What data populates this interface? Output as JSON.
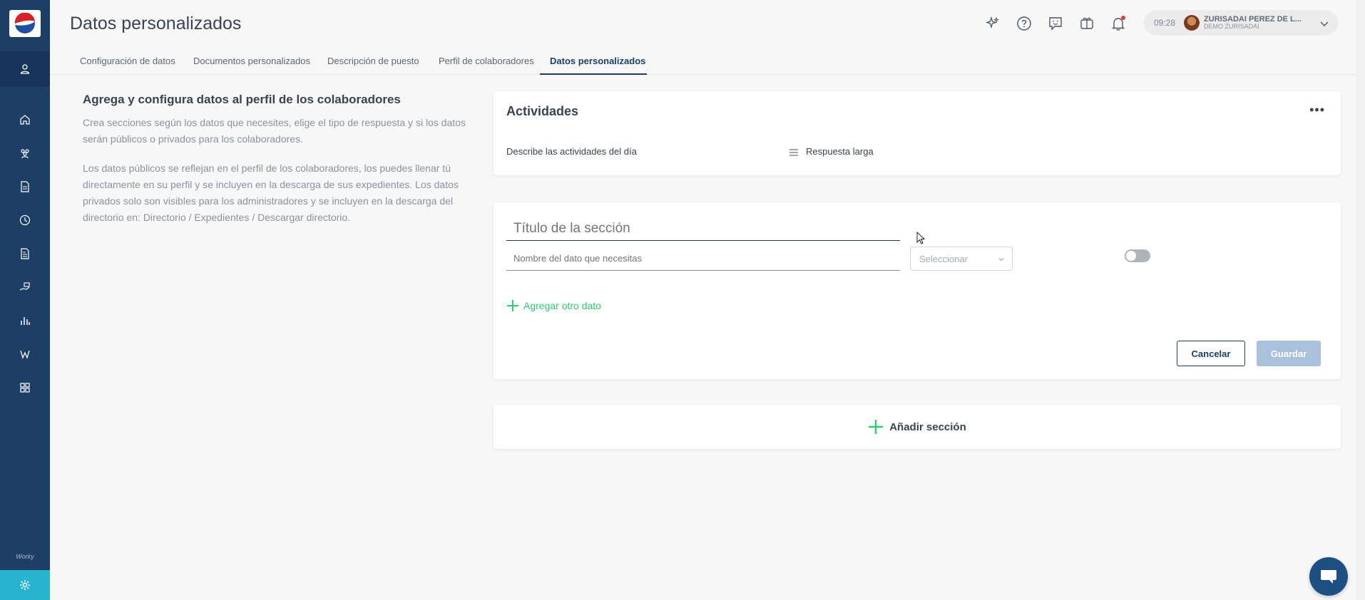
{
  "app": {
    "title": "Datos personalizados",
    "brand_color": "#1d3f66",
    "accent_color": "#2ecc71",
    "settings_color": "#28b4cf"
  },
  "sidebar": {
    "items": [
      {
        "icon": "user-icon"
      },
      {
        "icon": "home-icon"
      },
      {
        "icon": "users-icon"
      },
      {
        "icon": "document-icon"
      },
      {
        "icon": "clock-icon"
      },
      {
        "icon": "file-text-icon"
      },
      {
        "icon": "hand-money-icon"
      },
      {
        "icon": "bar-chart-icon"
      },
      {
        "icon": "network-icon"
      },
      {
        "icon": "grid-icon"
      }
    ],
    "footer_label": "Worky",
    "settings_icon": "gear-icon"
  },
  "header": {
    "icons": [
      "sparkles-icon",
      "help-icon",
      "feedback-icon",
      "gift-icon",
      "bell-icon"
    ],
    "user": {
      "time": "09:28",
      "name": "ZURISADAI PEREZ DE L...",
      "company": "DEMO ZURISADAI"
    }
  },
  "tabs": [
    {
      "label": "Configuración de datos",
      "active": false
    },
    {
      "label": "Documentos personalizados",
      "active": false
    },
    {
      "label": "Descripción de puesto",
      "active": false
    },
    {
      "label": "Perfil de colaboradores",
      "active": false
    },
    {
      "label": "Datos personalizados",
      "active": true
    }
  ],
  "intro": {
    "title": "Agrega y configura datos al perfil de los colaboradores",
    "paragraph1": "Crea secciones según los datos que necesites, elige el tipo de respuesta y si los datos serán públicos o privados para los colaboradores.",
    "paragraph2": "Los datos públicos se reflejan en el perfil de los colaboradores, los puedes llenar tú directamente en su perfil y se incluyen en la descarga de sus expedientes. Los datos privados solo son visibles para los administradores y se incluyen en la descarga del directorio en: Directorio / Expedientes / Descargar directorio."
  },
  "sections": [
    {
      "title": "Actividades",
      "fields": [
        {
          "label": "Describe las actividades del día",
          "type": "Respuesta larga"
        }
      ]
    }
  ],
  "new_section": {
    "title_placeholder": "Título de la sección",
    "field_placeholder": "Nombre del dato que necesitas",
    "select_placeholder": "Seleccionar",
    "toggle_on": false,
    "add_field_label": "Agregar otro dato",
    "cancel_label": "Cancelar",
    "save_label": "Guardar"
  },
  "add_section_label": "Añadir sección"
}
